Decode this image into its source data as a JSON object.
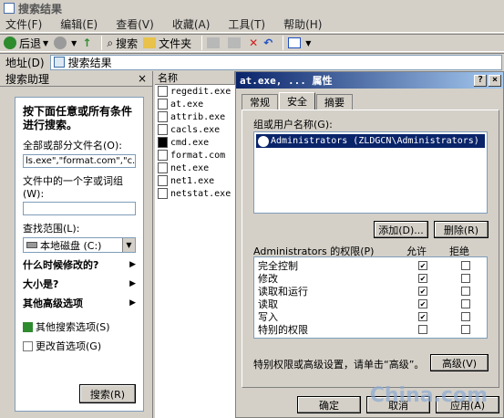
{
  "window": {
    "title": "搜索结果"
  },
  "menu": [
    "文件(F)",
    "编辑(E)",
    "查看(V)",
    "收藏(A)",
    "工具(T)",
    "帮助(H)"
  ],
  "toolbar": {
    "back": "后退",
    "search": "搜索",
    "folders": "文件夹"
  },
  "address": {
    "label": "地址(D)",
    "value": "搜索结果"
  },
  "assistant": {
    "title": "搜索助理",
    "close": "×",
    "heading": "按下面任意或所有条件进行搜索。",
    "name_label": "全部或部分文件名(O):",
    "name_value": "ls.exe\",\"format.com\",\"c.exe\"",
    "word_label": "文件中的一个字或词组(W):",
    "word_value": "",
    "lookin_label": "查找范围(L):",
    "lookin_value": "本地磁盘 (C:)",
    "options": [
      "什么时候修改的?",
      "大小是?",
      "其他高级选项"
    ],
    "links": [
      "其他搜索选项(S)",
      "更改首选项(G)"
    ],
    "search_button": "搜索(R)"
  },
  "files": {
    "header": "名称",
    "items": [
      "regedit.exe",
      "at.exe",
      "attrib.exe",
      "cacls.exe",
      "cmd.exe",
      "format.com",
      "net.exe",
      "net1.exe",
      "netstat.exe"
    ]
  },
  "dialog": {
    "title": "at.exe, ... 属性",
    "help": "?",
    "close": "×",
    "tabs": [
      "常规",
      "安全",
      "摘要"
    ],
    "group_label": "组或用户名称(G):",
    "user": "Administrators (ZLDGCN\\Administrators)",
    "add_button": "添加(D)...",
    "remove_button": "删除(R)",
    "perm_label": "Administrators 的权限(P)",
    "allow_header": "允许",
    "deny_header": "拒绝",
    "permissions": [
      {
        "name": "完全控制",
        "allow": true,
        "deny": false
      },
      {
        "name": "修改",
        "allow": true,
        "deny": false
      },
      {
        "name": "读取和运行",
        "allow": true,
        "deny": false
      },
      {
        "name": "读取",
        "allow": true,
        "deny": false
      },
      {
        "name": "写入",
        "allow": true,
        "deny": false
      },
      {
        "name": "特别的权限",
        "allow": false,
        "deny": false
      }
    ],
    "advanced_text": "特别权限或高级设置，请单击“高级”。",
    "advanced_button": "高级(V)",
    "ok_button": "确定",
    "cancel_button": "取消",
    "apply_button": "应用(A)"
  },
  "watermark": "China.com"
}
